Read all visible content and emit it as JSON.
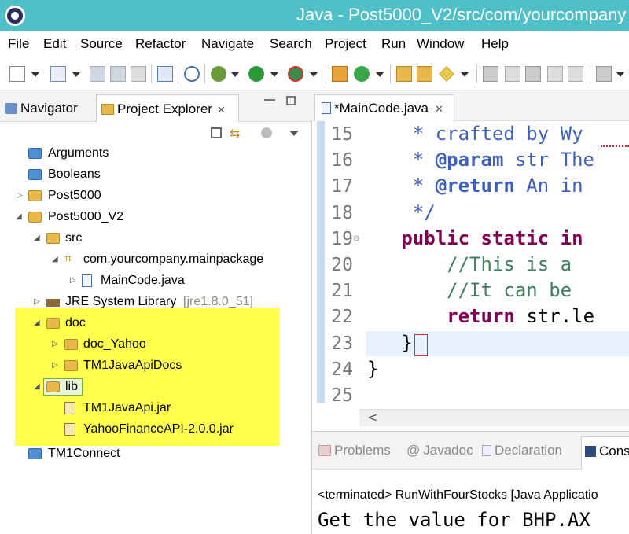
{
  "window": {
    "title": "Java - Post5000_V2/src/com/yourcompany"
  },
  "menu": [
    "File",
    "Edit",
    "Source",
    "Refactor",
    "Navigate",
    "Search",
    "Project",
    "Run",
    "Window",
    "Help"
  ],
  "left_panel": {
    "tabs": [
      {
        "label": "Navigator"
      },
      {
        "label": "Project Explorer"
      }
    ],
    "tree": [
      {
        "label": "Arguments"
      },
      {
        "label": "Booleans"
      },
      {
        "label": "Post5000"
      },
      {
        "label": "Post5000_V2"
      },
      {
        "label": "src"
      },
      {
        "label": "com.yourcompany.mainpackage"
      },
      {
        "label": "MainCode.java"
      },
      {
        "label": "JRE System Library",
        "suffix": "[jre1.8.0_51]"
      },
      {
        "label": "doc"
      },
      {
        "label": "doc_Yahoo"
      },
      {
        "label": "TM1JavaApiDocs"
      },
      {
        "label": "lib"
      },
      {
        "label": "TM1JavaApi.jar"
      },
      {
        "label": "YahooFinanceAPI-2.0.0.jar"
      },
      {
        "label": "TM1Connect"
      }
    ]
  },
  "editor": {
    "tab_label": "*MainCode.java",
    "lines": [
      {
        "num": "15",
        "text": "    * crafted by Wy"
      },
      {
        "num": "16",
        "text": "    * @param str The"
      },
      {
        "num": "17",
        "text": "    * @return An in"
      },
      {
        "num": "18",
        "text": "    */"
      },
      {
        "num": "19",
        "text": "   public static in"
      },
      {
        "num": "20",
        "text": "       //This is a"
      },
      {
        "num": "21",
        "text": "       //It can be"
      },
      {
        "num": "22",
        "text": "       return str.le"
      },
      {
        "num": "23",
        "text": "   }"
      },
      {
        "num": "24",
        "text": "}"
      },
      {
        "num": "25",
        "text": ""
      }
    ],
    "scroll_left": "<"
  },
  "bottom_panel": {
    "tabs": [
      {
        "label": "Problems"
      },
      {
        "label": "Javadoc"
      },
      {
        "label": "Declaration"
      },
      {
        "label": "Cons"
      }
    ],
    "terminated": "<terminated> RunWithFourStocks [Java Applicatio",
    "output": "Get the value for BHP.AX"
  },
  "colors": {
    "titlebar": "#4fc0c7",
    "highlight": "#ffff4d",
    "keyword": "#7f0055",
    "comment": "#3f5fbf",
    "line_comment": "#3f7f5f"
  }
}
